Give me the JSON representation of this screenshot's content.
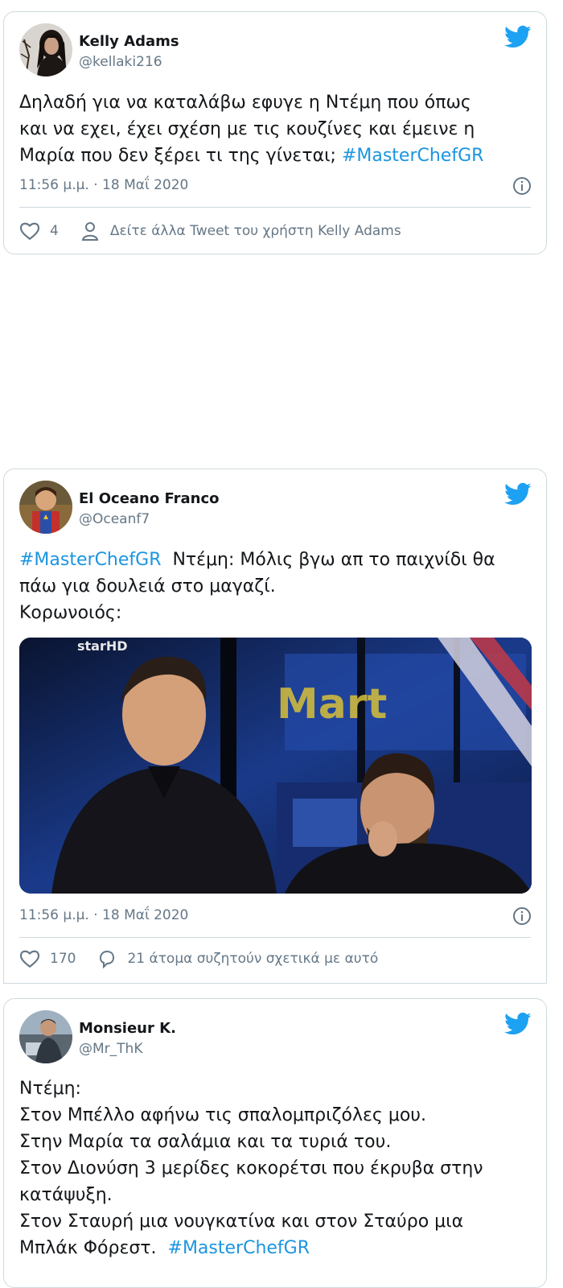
{
  "colors": {
    "link": "#1b95e0",
    "meta": "#657786",
    "border": "#cfd9de",
    "twitter_blue": "#1da1f2"
  },
  "tweets": [
    {
      "name": "Kelly Adams",
      "handle": "@kellaki216",
      "text_lines": [
        "Δηλαδή για να καταλάβω εφυγε η Ντέμη που όπως",
        "και να εχει, έχει σχέση με τις κουζίνες και έμεινε η",
        "Μαρία που δεν ξέρει τι της γίνεται;"
      ],
      "hashtag": "#MasterChefGR",
      "timestamp": "11:56 μ.μ. · 18 Μαΐ 2020",
      "likes": "4",
      "secondary_action": "Δείτε άλλα Tweet του χρήστη Kelly Adams",
      "icons": [
        "avatar",
        "twitter-bird-icon",
        "info-icon",
        "heart-icon",
        "person-icon"
      ]
    },
    {
      "name": "El Oceano Franco",
      "handle": "@Oceanf7",
      "hashtag": "#MasterChefGR",
      "text_line1_rest": "  Ντέμη: Μόλις βγω απ το παιχνίδι θα",
      "text_lines": [
        "πάω για δουλειά στο μαγαζί.",
        "Κορωνοιός:"
      ],
      "media_logo": "starHD",
      "media_sign": "Mart",
      "timestamp": "11:56 μ.μ. · 18 Μαΐ 2020",
      "likes": "170",
      "secondary_action": "21 άτομα συζητούν σχετικά με αυτό",
      "icons": [
        "avatar",
        "twitter-bird-icon",
        "info-icon",
        "heart-icon",
        "reply-bubble-icon"
      ]
    },
    {
      "name": "Monsieur K.",
      "handle": "@Mr_ThK",
      "text_lines": [
        "Ντέμη:",
        "Στον Μπέλλο αφήνω τις σπαλομπριζόλες μου.",
        "Στην Μαρία τα σαλάμια και τα τυριά του.",
        "Στον Διονύση 3 μερίδες κοκορέτσι που έκρυβα στην",
        "κατάψυξη.",
        "Στον Σταυρή μια νουγκατίνα και στον Σταύρο μια"
      ],
      "last_line": "Μπλάκ Φόρεστ.  ",
      "hashtag": "#MasterChefGR",
      "icons": [
        "avatar",
        "twitter-bird-icon"
      ]
    }
  ]
}
